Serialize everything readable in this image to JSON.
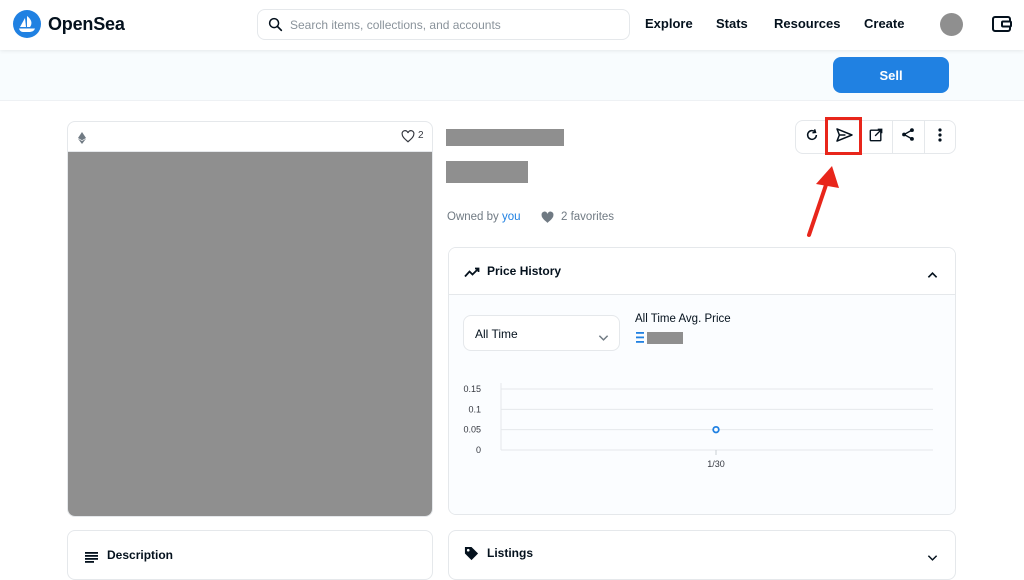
{
  "header": {
    "logo_text": "OpenSea",
    "search_placeholder": "Search items, collections, and accounts",
    "nav": [
      "Explore",
      "Stats",
      "Resources",
      "Create"
    ],
    "accent_color": "#2081e2"
  },
  "toolbar": {
    "sell_label": "Sell"
  },
  "item": {
    "chain_icon": "ethereum-icon",
    "like_count": "2",
    "owned_by_prefix": "Owned by",
    "owner": "you",
    "favorites_text": "2 favorites"
  },
  "actions": {
    "icons": [
      "refresh-icon",
      "send-icon",
      "external-link-icon",
      "share-icon",
      "more-icon"
    ],
    "highlight_color": "#e8261b"
  },
  "price_history": {
    "title": "Price History",
    "range_selected": "All Time",
    "avg_label": "All Time Avg. Price"
  },
  "chart_data": {
    "type": "scatter",
    "title": "",
    "xlabel": "",
    "ylabel": "",
    "yticks": [
      "0.15",
      "0.1",
      "0.05",
      "0"
    ],
    "ylim": [
      0,
      0.15
    ],
    "xticks": [
      "1/30"
    ],
    "points": [
      {
        "x": "1/30",
        "y": 0.05
      }
    ],
    "grid": true
  },
  "panels": {
    "description_title": "Description",
    "listings_title": "Listings"
  }
}
